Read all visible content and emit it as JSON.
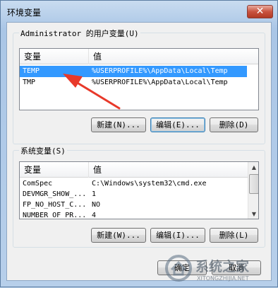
{
  "window": {
    "title": "环境变量",
    "close_glyph": "✕"
  },
  "user_vars": {
    "group_label": "Administrator 的用户变量(U)",
    "col_variable": "变量",
    "col_value": "值",
    "rows": [
      {
        "name": "TEMP",
        "value": "%USERPROFILE%\\AppData\\Local\\Temp",
        "selected": true
      },
      {
        "name": "TMP",
        "value": "%USERPROFILE%\\AppData\\Local\\Temp",
        "selected": false
      }
    ],
    "buttons": {
      "new": "新建(N)...",
      "edit": "编辑(E)...",
      "delete": "删除(D)"
    }
  },
  "system_vars": {
    "group_label": "系统变量(S)",
    "col_variable": "变量",
    "col_value": "值",
    "rows": [
      {
        "name": "ComSpec",
        "value": "C:\\Windows\\system32\\cmd.exe"
      },
      {
        "name": "DEVMGR_SHOW_...",
        "value": "1"
      },
      {
        "name": "FP_NO_HOST_C...",
        "value": "NO"
      },
      {
        "name": "NUMBER_OF_PR...",
        "value": "4"
      }
    ],
    "buttons": {
      "new": "新建(W)...",
      "edit": "编辑(I)...",
      "delete": "删除(L)"
    }
  },
  "footer": {
    "ok": "确定",
    "cancel": "取消"
  },
  "watermark": {
    "text": "系统之家",
    "url": "XITONGZHIJIA.NET"
  },
  "colors": {
    "selection": "#3399ff",
    "annotation_arrow": "#e8392a"
  }
}
